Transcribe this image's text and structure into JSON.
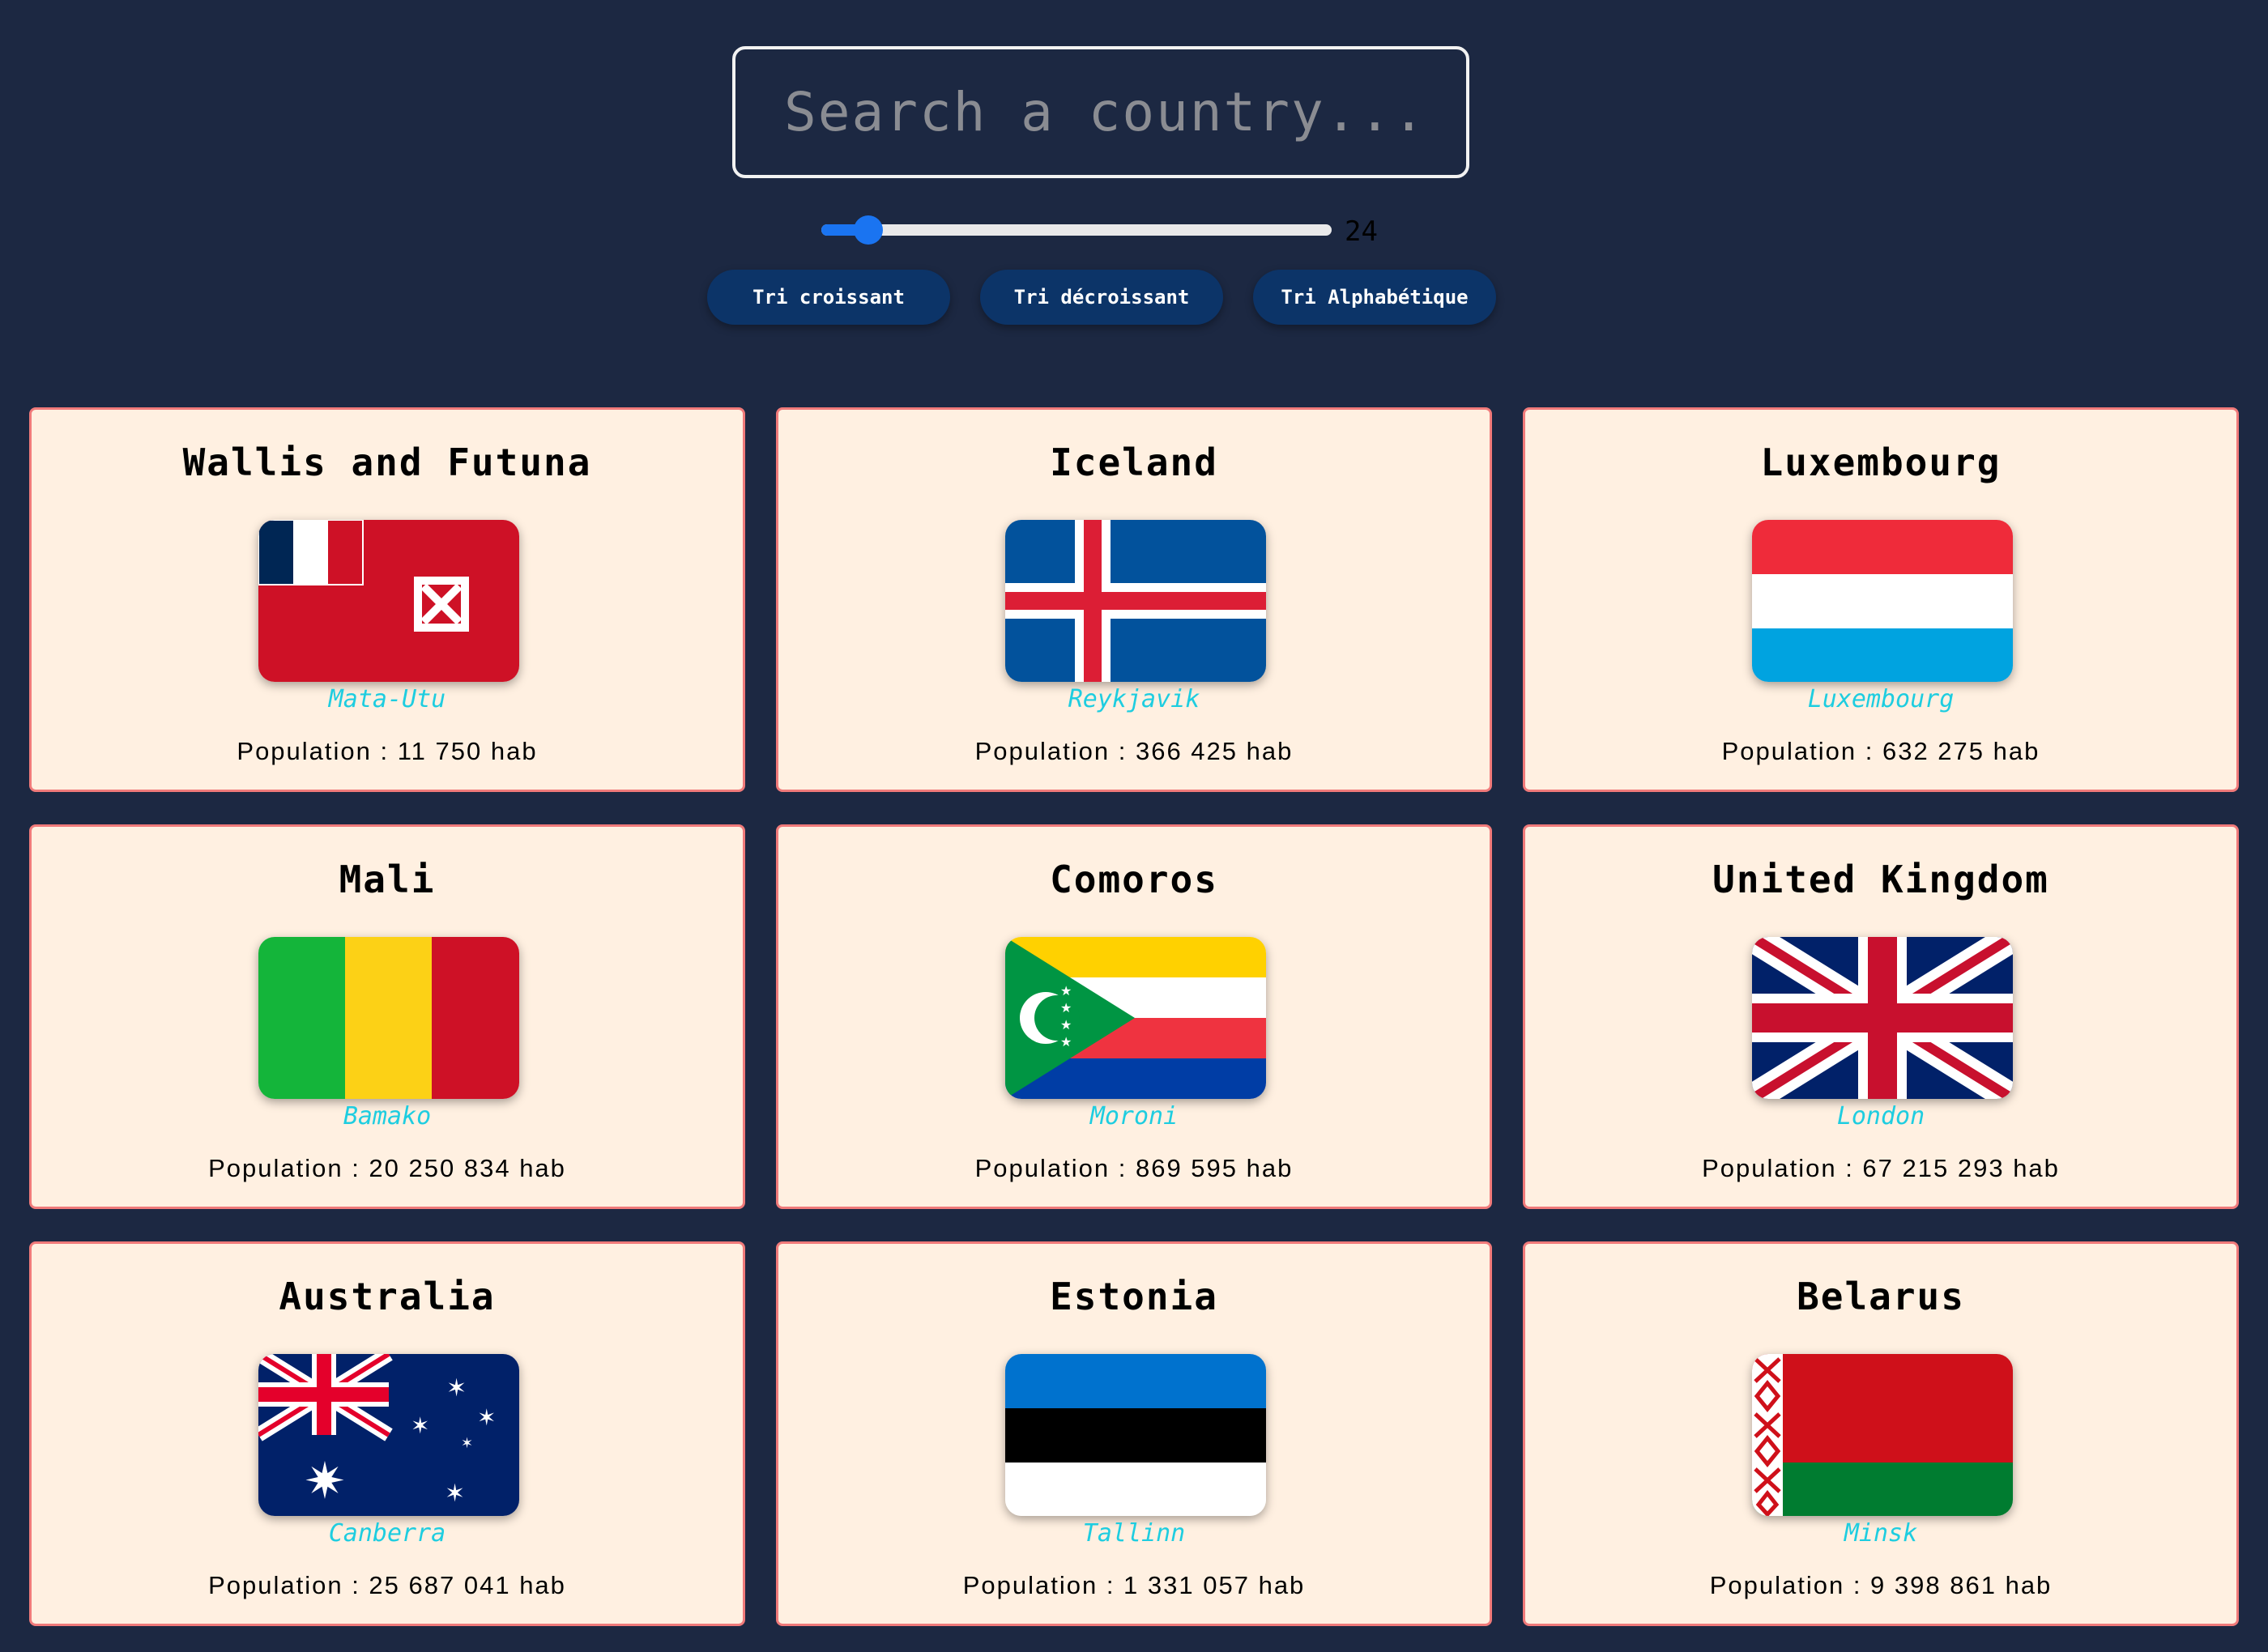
{
  "search": {
    "placeholder": "Search a country...",
    "value": ""
  },
  "range": {
    "value": 24,
    "min": 1,
    "max": 250,
    "value_label": "24"
  },
  "sort_buttons": [
    {
      "label": "Tri croissant"
    },
    {
      "label": "Tri décroissant"
    },
    {
      "label": "Tri Alphabétique"
    }
  ],
  "colors": {
    "background": "#1c2842",
    "card": "#fff0e1",
    "card_border": "#f07a7a",
    "capital": "#1ecde0",
    "button": "#0c3468",
    "slider": "#1a74f1"
  },
  "countries": [
    {
      "name": "Wallis and Futuna",
      "capital": "Mata-Utu",
      "population": "Population : 11 750 hab",
      "flag_icon": "wallis-futuna-flag-icon"
    },
    {
      "name": "Iceland",
      "capital": "Reykjavik",
      "population": "Population : 366 425 hab",
      "flag_icon": "iceland-flag-icon"
    },
    {
      "name": "Luxembourg",
      "capital": "Luxembourg",
      "population": "Population : 632 275 hab",
      "flag_icon": "luxembourg-flag-icon"
    },
    {
      "name": "Mali",
      "capital": "Bamako",
      "population": "Population : 20 250 834 hab",
      "flag_icon": "mali-flag-icon"
    },
    {
      "name": "Comoros",
      "capital": "Moroni",
      "population": "Population : 869 595 hab",
      "flag_icon": "comoros-flag-icon"
    },
    {
      "name": "United Kingdom",
      "capital": "London",
      "population": "Population : 67 215 293 hab",
      "flag_icon": "united-kingdom-flag-icon"
    },
    {
      "name": "Australia",
      "capital": "Canberra",
      "population": "Population : 25 687 041 hab",
      "flag_icon": "australia-flag-icon"
    },
    {
      "name": "Estonia",
      "capital": "Tallinn",
      "population": "Population : 1 331 057 hab",
      "flag_icon": "estonia-flag-icon"
    },
    {
      "name": "Belarus",
      "capital": "Minsk",
      "population": "Population : 9 398 861 hab",
      "flag_icon": "belarus-flag-icon"
    }
  ]
}
